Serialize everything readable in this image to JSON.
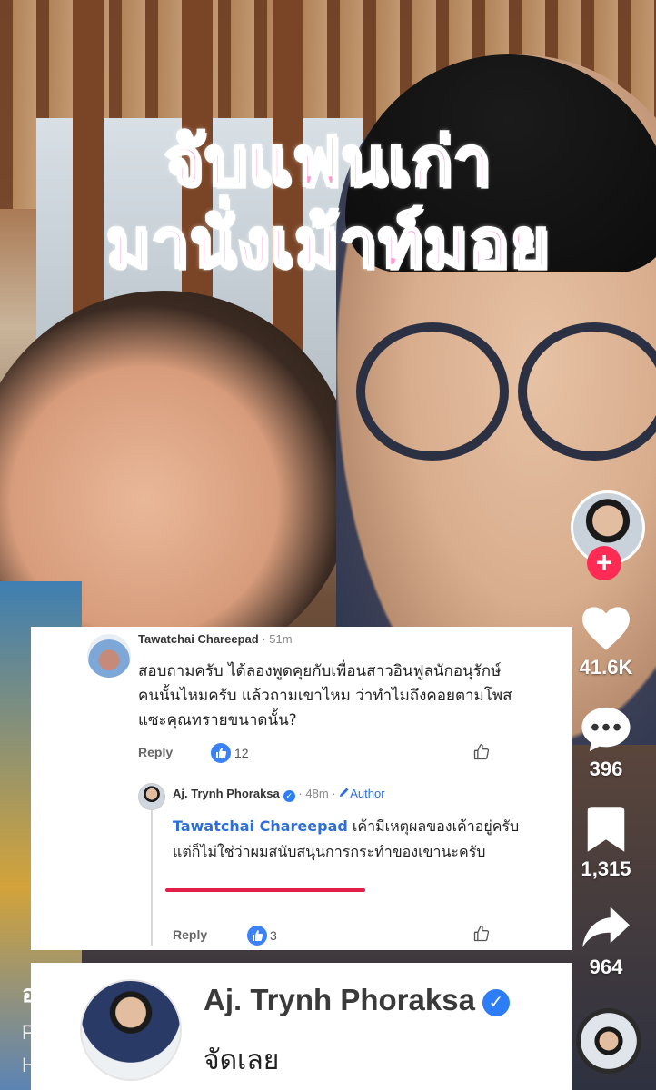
{
  "video": {
    "overlay_line1": "จับแฟนเก่า",
    "overlay_line2": "มานั่งเม้าท์มอย"
  },
  "rail": {
    "likes": "41.6K",
    "comments": "396",
    "saves": "1,315",
    "shares": "964",
    "follow_symbol": "+"
  },
  "comment": {
    "author": "Tawatchai Chareepad",
    "separator": "·",
    "time": "51m",
    "text": "สอบถามครับ ได้ลองพูดคุยกับเพื่อนสาวอินฟูลนักอนุรักษ์คนนั้นไหมครับ แล้วถามเขาไหม ว่าทำไมถึงคอยตามโพสแซะคุณทรายขนาดนั้น?",
    "reply_label": "Reply",
    "like_count": "12"
  },
  "reply": {
    "author": "Aj. Trynh Phoraksa",
    "verified_symbol": "✓",
    "separator": "·",
    "time": "48m",
    "separator2": "·",
    "author_badge": "Author",
    "mention": "Tawatchai Chareepad",
    "text_line1": "เค้ามีเหตุผลของเค้าอยู่ครับ",
    "text_line2": "แต่ก็ไม่ใช่ว่าผมสนับสนุนการกระทำของเขานะครับ",
    "reply_label": "Reply",
    "like_count": "3"
  },
  "profile_card": {
    "name": "Aj. Trynh Phoraksa",
    "verified_symbol": "✓",
    "reply_text": "จัดเลย"
  },
  "caption_partial": {
    "line1": "อ",
    "line2": "P",
    "line3": "H"
  },
  "colors": {
    "overlay_pink": "#ff9ad1",
    "follow_red": "#fe2c55",
    "link_blue": "#2d6fd6",
    "underline_red": "#e11d48"
  },
  "icons": [
    "heart-icon",
    "comment-icon",
    "bookmark-icon",
    "share-icon",
    "thumbs-up-icon",
    "pencil-icon",
    "verified-icon"
  ]
}
